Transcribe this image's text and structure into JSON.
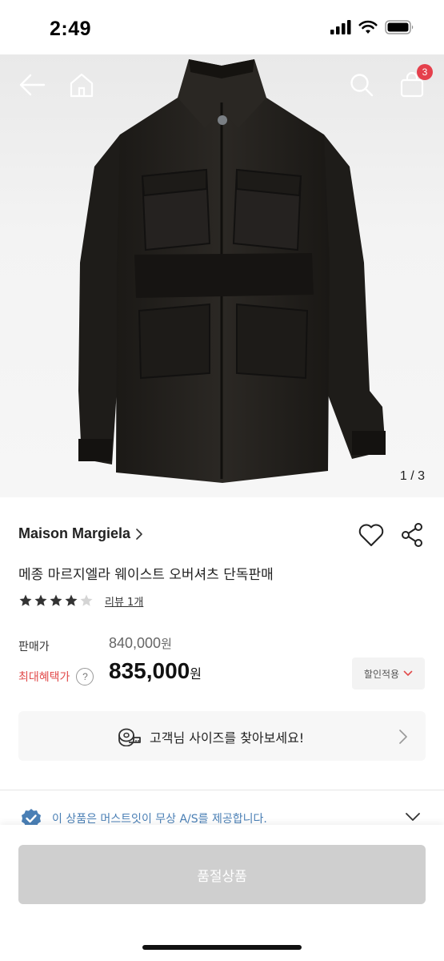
{
  "status_bar": {
    "time": "2:49"
  },
  "nav": {
    "cart_count": "3"
  },
  "gallery": {
    "pager": "1 / 3"
  },
  "product": {
    "brand": "Maison Margiela",
    "title": "메종 마르지엘라 웨이스트 오버셔츠 단독판매",
    "rating": 4,
    "rating_max": 5,
    "review_link": "리뷰 1개"
  },
  "price": {
    "sale_label": "판매가",
    "sale_value": "840,000",
    "sale_unit": "원",
    "benefit_label": "최대혜택가",
    "help_symbol": "?",
    "benefit_value": "835,000",
    "benefit_unit": "원",
    "discount_button": "할인적용"
  },
  "size_finder": {
    "label": "고객님 사이즈를 찾아보세요!"
  },
  "as_notice": {
    "text": "이 상품은 머스트잇이 무상 A/S를 제공합니다."
  },
  "bottom": {
    "soldout_label": "품절상품"
  },
  "colors": {
    "accent_red": "#e24b4b",
    "badge_red": "#e5404c",
    "as_blue": "#4a7fb5",
    "disabled_gray": "#cfcfcf"
  },
  "icons": [
    "signal-icon",
    "wifi-icon",
    "battery-icon",
    "back-arrow-icon",
    "home-icon",
    "search-icon",
    "cart-icon",
    "chevron-right-icon",
    "heart-icon",
    "share-icon",
    "star-icon",
    "tape-measure-icon",
    "verified-check-icon",
    "chevron-down-icon"
  ]
}
